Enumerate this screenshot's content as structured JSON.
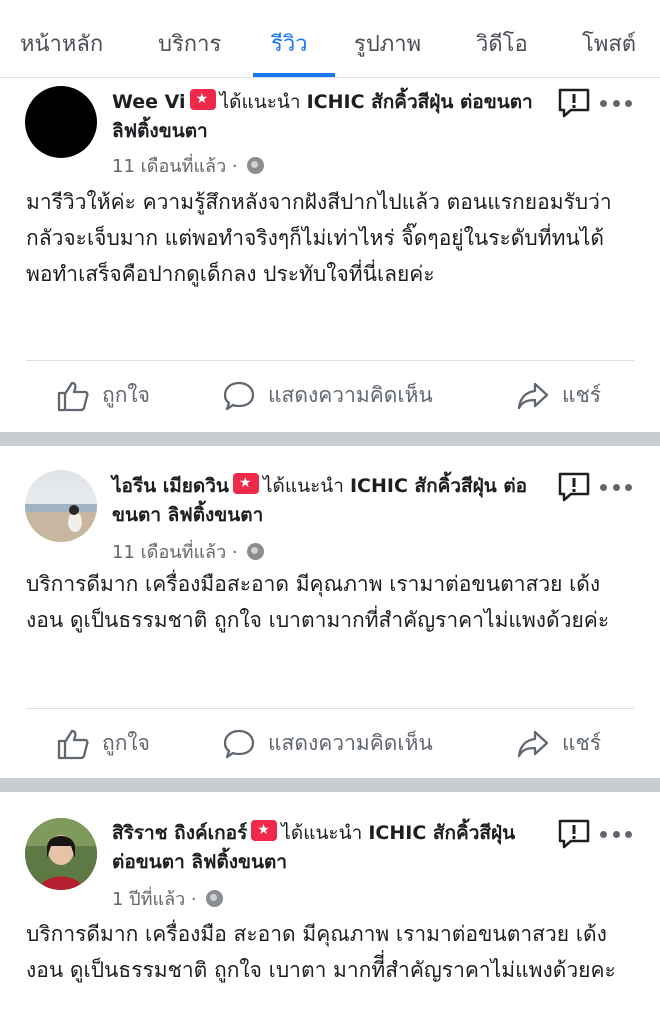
{
  "tabs": [
    {
      "label": "หน้าหลัก"
    },
    {
      "label": "บริการ"
    },
    {
      "label": "รีวิว",
      "active": true
    },
    {
      "label": "รูปภาพ"
    },
    {
      "label": "วิดีโอ"
    },
    {
      "label": "โพสต์"
    }
  ],
  "colors": {
    "accent": "#1877f2",
    "recommend_badge": "#f02849",
    "divider": "#c9ccd1"
  },
  "posts": [
    {
      "author": "Wee Vi",
      "verb": "ได้แนะนำ",
      "page": "ICHIC สักคิ้วสีฝุ่น ต่อขนตา ลิฟติ้งขนตา",
      "time": "11 เดือนที่แล้ว · ",
      "text": "มารีวิวให้ค่ะ ความรู้สึกหลังจากฝังสีปากไปแล้ว ตอนแรกยอมรับว่ากลัวจะเจ็บมาก แต่พอทำจริงๆก็ไม่เท่าไหร่ จิ๊ดๆอยู่ในระดับที่ทนได้ พอทำเสร็จคือปากดูเด็กลง ประทับใจที่นี่เลยค่ะ",
      "avatar": "black-circle"
    },
    {
      "author": "ไอรีน เมียดวิน",
      "verb": "ได้แนะนำ",
      "page": "ICHIC สักคิ้วสีฝุ่น ต่อขนตา ลิฟติ้งขนตา",
      "time": "11 เดือนที่แล้ว · ",
      "text": "บริการดีมาก เครื่องมือสะอาด มีคุณภาพ เรามาต่อขนตาสวย เด้งงอน ดูเป็นธรรมชาติ ถูกใจ เบาตามากที่สำคัญราคาไม่แพงด้วยค่ะ",
      "avatar": "beach-photo"
    },
    {
      "author": "สิริราช ถิงค์เกอร์",
      "verb": "ได้แนะนำ",
      "page": "ICHIC สักคิ้วสีฝุ่น ต่อขนตา ลิฟติ้งขนตา",
      "time": "1 ปีที่แล้ว · ",
      "text": "บริการดีมาก เครื่องมือ สะอาด มีคุณภาพ เรามาต่อขนตาสวย เด้งงอน ดูเป็นธรรมชาติ ถูกใจ เบาตา มากทีี่สำคัญราคาไม่แพงด้วยคะ",
      "avatar": "portrait-photo"
    }
  ],
  "actions": {
    "like": "ถูกใจ",
    "comment": "แสดงความคิดเห็น",
    "share": "แชร์"
  },
  "icons": [
    "thumbs-up-icon",
    "comment-icon",
    "share-icon",
    "message-icon",
    "more-icon",
    "globe-icon",
    "recommend-icon"
  ]
}
